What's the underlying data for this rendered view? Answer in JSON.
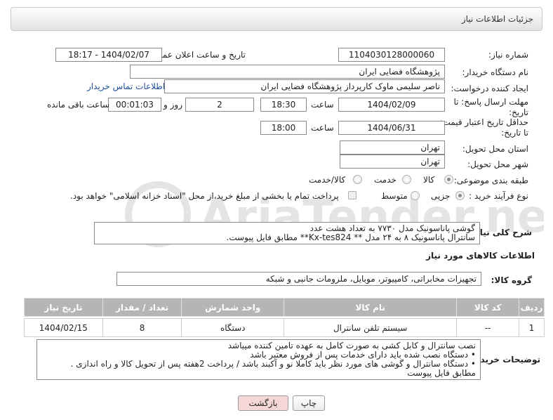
{
  "header": {
    "title": "جزئیات اطلاعات نیاز"
  },
  "form": {
    "need_number_label": "شماره نیاز:",
    "need_number": "1104030128000060",
    "announce_label": "تاریخ و ساعت اعلان عمومی:",
    "announce_value": "1404/02/07 - 18:17",
    "buyer_org_label": "نام دستگاه خریدار:",
    "buyer_org": "پژوهشگاه فضایی ایران",
    "creator_label": "ایجاد کننده درخواست:",
    "creator": "ناصر سلیمی ماوک کارپرداز پژوهشگاه فضایی ایران",
    "contact_link": "اطلاعات تماس خریدار",
    "deadline_label_1": "مهلت ارسال پاسخ: تا",
    "deadline_label_2": "تاریخ:",
    "deadline_date": "1404/02/09",
    "time_word": "ساعت",
    "deadline_time": "18:30",
    "days_value": "2",
    "days_and": "روز و",
    "remaining_time": "00:01:03",
    "remaining_label": "ساعت باقی مانده",
    "validity_label_1": "حداقل تاریخ اعتبار قیمت:",
    "validity_label_2": "تا تاریخ:",
    "validity_date": "1404/06/31",
    "validity_time": "18:00",
    "province_label": "استان محل تحویل:",
    "province": "تهران",
    "city_label": "شهر محل تحویل:",
    "city": "تهران",
    "category_label": "طبقه بندی موضوعی:",
    "category_options": [
      "کالا",
      "خدمت",
      "کالا/خدمت"
    ],
    "category_selected": "کالا",
    "purchase_type_label": "نوع فرآیند خرید :",
    "purchase_options": [
      "جزیی",
      "متوسط"
    ],
    "purchase_selected": "جزیی",
    "payment_note": "پرداخت تمام یا بخشی از مبلغ خرید،از محل \"اسناد خزانه اسلامی\" خواهد بود."
  },
  "description": {
    "label": "شرح کلی نیاز:",
    "line1": "گوشی پاناسونیک مدل ۷۷۳۰ به تعداد هشت عدد",
    "line2": "سانترال پاناسونیک ۸ به ۲۴ مدل ** Kx-tes824** مطابق فایل پیوست."
  },
  "goods": {
    "section_title": "اطلاعات کالاهای مورد نیاز",
    "group_label": "گروه کالا:",
    "group_value": "تجهیزات مخابراتی، کامپیوتر، موبایل، ملزومات جانبی و شبکه",
    "columns": [
      "ردیف",
      "کد کالا",
      "نام کالا",
      "واحد شمارش",
      "تعداد / مقدار",
      "تاریخ نیاز"
    ],
    "rows": [
      {
        "row": "1",
        "code": "--",
        "name": "سیستم تلفن سانترال",
        "unit": "دستگاه",
        "qty": "8",
        "date": "1404/02/15"
      }
    ]
  },
  "buyer_notes": {
    "label": "توضیحات خریدار:",
    "lines": [
      "نصب سانترال و کابل کشی به صورت کامل به عهده تامین کننده میباشد",
      "• دستگاه نصب شده باید دارای خدمات پس از فروش معتبر باشد",
      "• دستگاه سانترال و گوشی های مورد نظر باید کاملا نو و آکبند باشد / پرداخت 2هفته پس از تحویل کالا و راه اندازی .",
      "مطابق فایل پیوست"
    ]
  },
  "buttons": {
    "print": "چاپ",
    "back": "بازگشت"
  },
  "watermark": {
    "text": "AriaTender.net"
  },
  "colors": {
    "link": "#1f4f9c",
    "back_button_bg": "#f6d7d7",
    "table_header": "#b5b5b5"
  }
}
